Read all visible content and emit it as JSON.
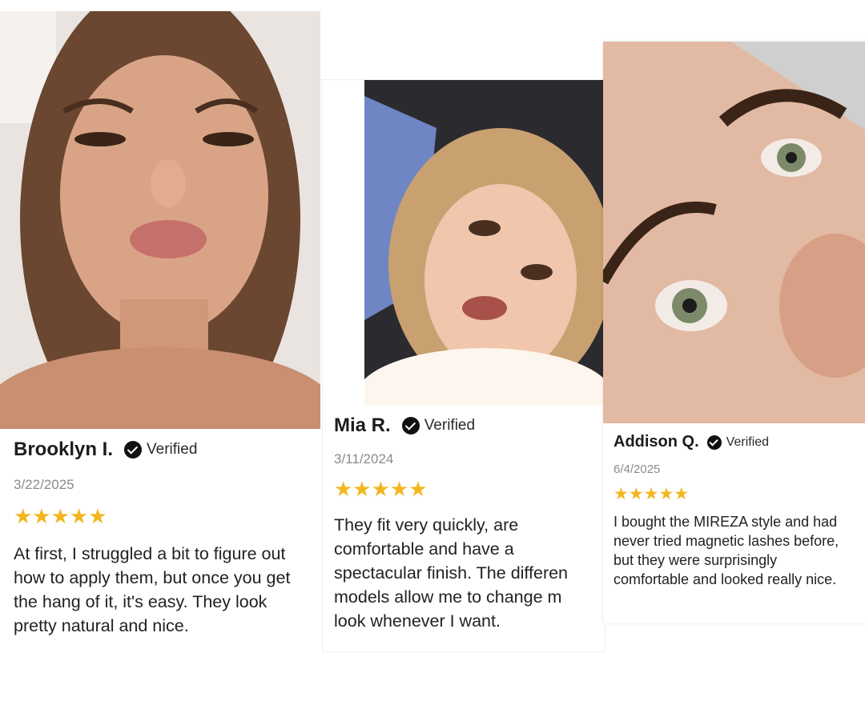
{
  "reviews": [
    {
      "name": "Brooklyn I.",
      "verified_label": "Verified",
      "date": "3/22/2025",
      "rating": 5,
      "stars": "★★★★★",
      "text": "At first, I struggled a bit to figure out how to apply them, but once you get the hang of it, it's easy. They look pretty natural and nice."
    },
    {
      "name": "Mia R.",
      "verified_label": "Verified",
      "date": "3/11/2024",
      "rating": 5,
      "stars": "★★★★★",
      "text_lines": [
        "They fit very quickly, are",
        "comfortable and have a",
        "spectacular finish. The differen",
        "models allow me to change m",
        "look whenever I want."
      ]
    },
    {
      "name": "Addison Q.",
      "verified_label": "Verified",
      "date": "6/4/2025",
      "rating": 5,
      "stars": "★★★★★",
      "text": "I bought the MIREZA style and had never tried magnetic lashes before, but they were surprisingly comfortable and looked really nice."
    }
  ],
  "colors": {
    "star": "#f2b61f",
    "date": "#8a8a8a",
    "text": "#222222"
  }
}
